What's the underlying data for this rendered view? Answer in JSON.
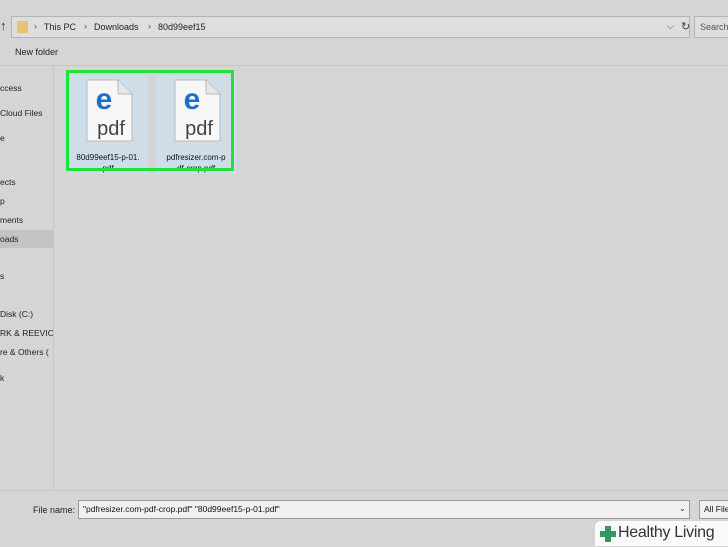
{
  "address_bar": {
    "breadcrumbs": [
      "This PC",
      "Downloads",
      "80d99eef15"
    ],
    "separator": "›",
    "up_arrow": "↑",
    "dropdown_glyph": "⌵",
    "refresh_glyph": "↻",
    "folder_color": "#e3c374"
  },
  "search": {
    "placeholder": "Search"
  },
  "toolbar": {
    "new_folder": "New folder"
  },
  "nav": {
    "items": [
      {
        "label": "ccess"
      },
      {
        "label": "Cloud Files"
      },
      {
        "label": "e"
      },
      {
        "label": "ects"
      },
      {
        "label": "p"
      },
      {
        "label": "ments"
      },
      {
        "label": "oads",
        "selected": true
      },
      {
        "label": "s"
      },
      {
        "label": "Disk (C:)"
      },
      {
        "label": "RK & REEVIO"
      },
      {
        "label": "re & Others ("
      },
      {
        "label": "k"
      }
    ]
  },
  "files": [
    {
      "name": "80d99eef15-p-01.pdf",
      "label": "80d99eef15-p-01.\npdf",
      "icon": "edge-pdf-icon",
      "icon_text": "pdf"
    },
    {
      "name": "pdfresizer.com-pdf-crop.pdf",
      "label": "pdfresizer.com-p\ndf-crop.pdf",
      "icon": "edge-pdf-icon",
      "icon_text": "pdf"
    }
  ],
  "bottom": {
    "file_name_label": "File name:",
    "file_name_value": "\"pdfresizer.com-pdf-crop.pdf\" \"80d99eef15-p-01.pdf\"",
    "file_type_value": "All Files"
  },
  "colors": {
    "selection_outline": "#1ee33c",
    "edge_blue": "#1b6fc9",
    "selected_tile": "#cfdde9"
  },
  "watermark": {
    "text": "Healthy Living"
  }
}
